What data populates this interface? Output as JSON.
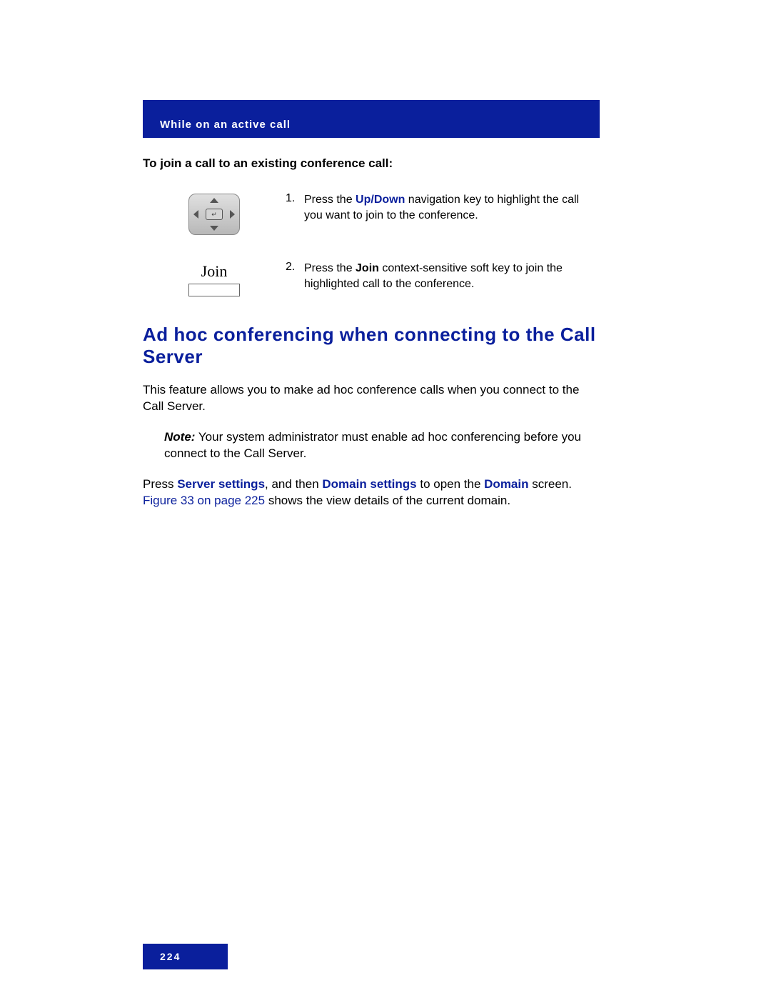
{
  "header": {
    "section_title": "While on an active call"
  },
  "instr_title": "To join a call to an existing conference call:",
  "steps": {
    "s1": {
      "number": "1.",
      "pre": "Press the ",
      "up": "Up",
      "slash": "/",
      "down": "Down",
      "post": " navigation key to highlight the call you want to join to the conference."
    },
    "s2": {
      "number": "2.",
      "pre": "Press the ",
      "join": "Join",
      "post": " context-sensitive soft key to join the highlighted call to the conference."
    }
  },
  "softkey": {
    "join_label": "Join"
  },
  "section_heading": "Ad hoc conferencing when connecting to the Call Server",
  "para_intro": "This feature allows you to make ad hoc conference calls when you connect to the Call Server.",
  "note": {
    "label": "Note:",
    "spacer": "  ",
    "text": "Your system administrator must enable ad hoc conferencing before you connect to the Call Server."
  },
  "para_press": {
    "t1": "Press ",
    "server_settings": "Server settings",
    "t2": ", and then ",
    "domain_settings": "Domain settings",
    "t3": " to open the ",
    "domain": "Domain",
    "t4": " screen. ",
    "xref": "Figure 33 on page 225",
    "t5": " shows the view details of the current domain."
  },
  "footer": {
    "page_number": "224"
  }
}
